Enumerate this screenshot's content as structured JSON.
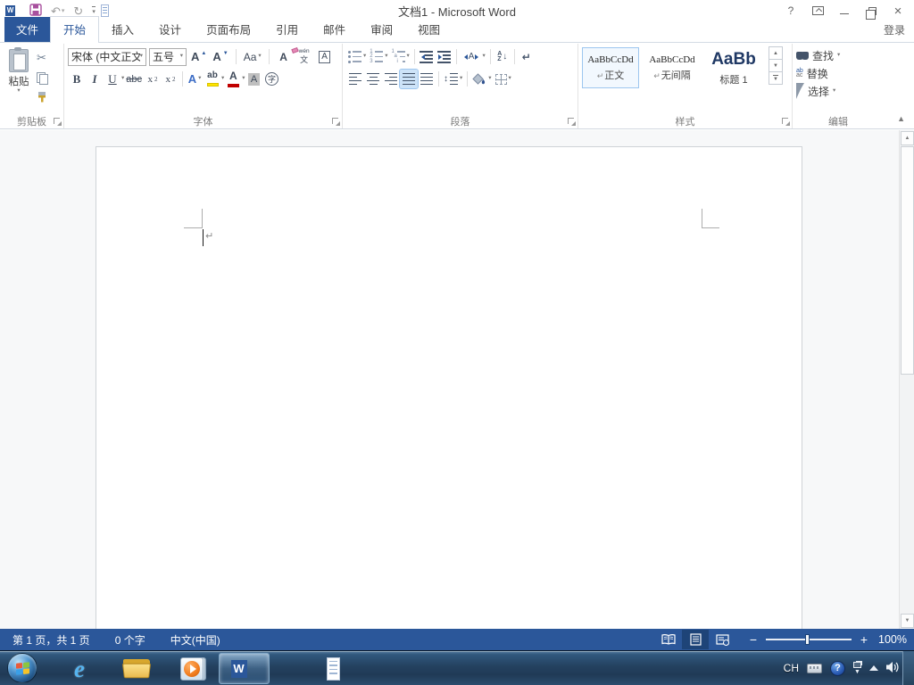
{
  "window": {
    "title": "文档1 - Microsoft Word",
    "help": "?",
    "sign_in": "登录"
  },
  "qat": {
    "undo": "↶",
    "redo": "↻",
    "customize": "▾"
  },
  "tabs": {
    "items": [
      {
        "label": "文件"
      },
      {
        "label": "开始"
      },
      {
        "label": "插入"
      },
      {
        "label": "设计"
      },
      {
        "label": "页面布局"
      },
      {
        "label": "引用"
      },
      {
        "label": "邮件"
      },
      {
        "label": "审阅"
      },
      {
        "label": "视图"
      }
    ]
  },
  "ribbon": {
    "clipboard": {
      "paste_label": "粘贴",
      "cut_glyph": "✂",
      "group_label": "剪贴板"
    },
    "font": {
      "font_name": "宋体 (中文正文",
      "font_size": "五号",
      "grow": "A",
      "shrink": "A",
      "change_case": "Aa",
      "clear_format": "A",
      "phonetic_top": "wén",
      "phonetic_bottom": "文",
      "char_border": "A",
      "bold": "B",
      "italic": "I",
      "underline": "U",
      "strikethrough": "abc",
      "sub_base": "x",
      "sub_mark": "2",
      "sup_base": "x",
      "sup_mark": "2",
      "text_effects": "A",
      "highlight": "ab",
      "font_color": "A",
      "char_shading": "A",
      "enclose": "字",
      "group_label": "字体"
    },
    "paragraph": {
      "sort_a": "A",
      "sort_z": "Z",
      "sort_arrow": "↓",
      "para_mark": "↵",
      "spacing_arrow": "↕",
      "asian_label": "A",
      "group_label": "段落"
    },
    "styles": {
      "items": [
        {
          "preview": "AaBbCcDd",
          "mark": "↵",
          "name": "正文"
        },
        {
          "preview": "AaBbCcDd",
          "mark": "↵",
          "name": "无间隔"
        },
        {
          "preview": "AaBb",
          "mark": "",
          "name": "标题 1"
        }
      ],
      "group_label": "样式"
    },
    "editing": {
      "find": "查找",
      "replace": "替换",
      "select": "选择",
      "replace_top": "ab",
      "replace_bottom": "ac",
      "group_label": "编辑"
    }
  },
  "document": {
    "pilcrow": "↵"
  },
  "statusbar": {
    "page_info": "第 1 页，共 1 页",
    "word_count": "0 个字",
    "language": "中文(中国)",
    "zoom_out": "−",
    "zoom_in": "+",
    "zoom_level": "100%"
  },
  "taskbar": {
    "ime_indicator": "CH",
    "tray_help": "?"
  },
  "colors": {
    "accent": "#2b579a",
    "status_bar": "#2b579a",
    "file_tab": "#2b579a",
    "highlight_yellow": "#ffe400",
    "font_color_red": "#c00000"
  }
}
